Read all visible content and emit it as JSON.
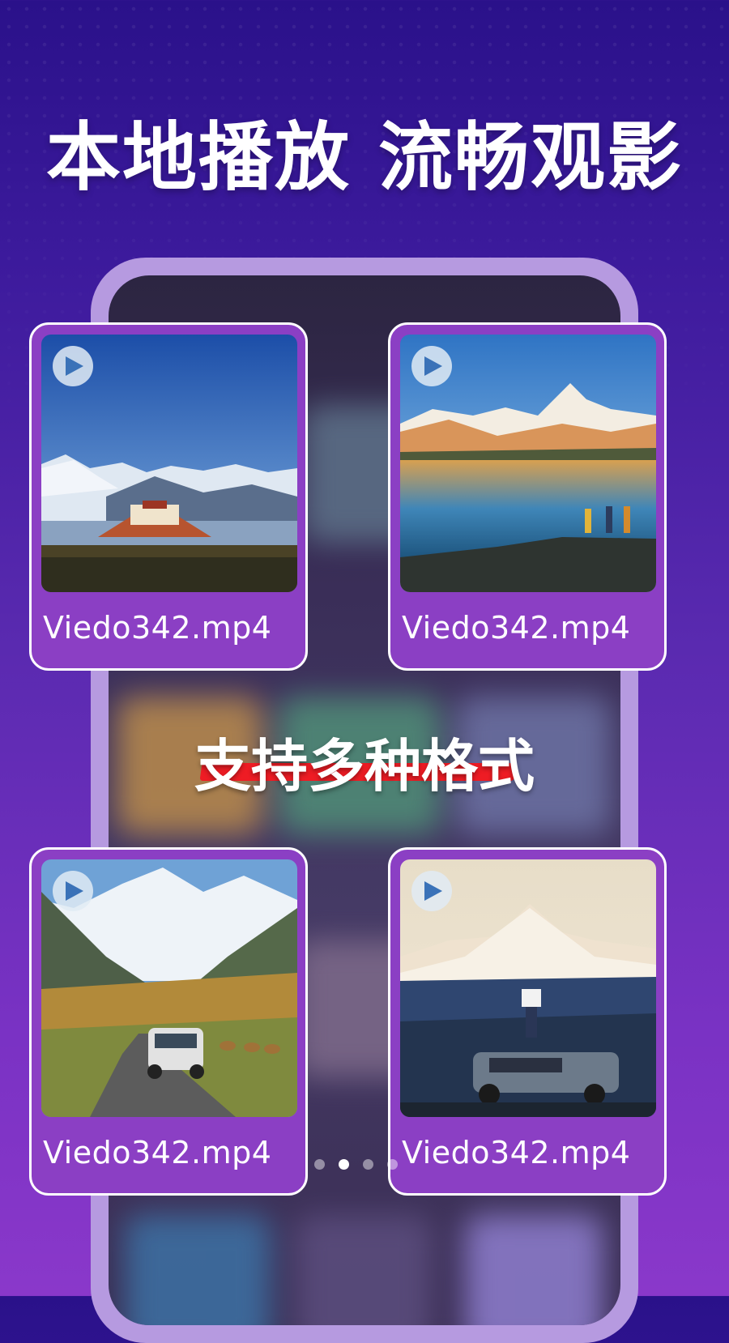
{
  "headline": "本地播放 流畅观影",
  "feature_caption": "支持多种格式",
  "videos": [
    {
      "filename": "Viedo342.mp4",
      "scene": "palace-mountains",
      "icon": "play-icon"
    },
    {
      "filename": "Viedo342.mp4",
      "scene": "lake-mountains",
      "icon": "play-icon"
    },
    {
      "filename": "Viedo342.mp4",
      "scene": "valley-road",
      "icon": "play-icon"
    },
    {
      "filename": "Viedo342.mp4",
      "scene": "summit-car",
      "icon": "play-icon"
    }
  ],
  "pager": {
    "count": 4,
    "active_index": 1
  },
  "colors": {
    "background_top": "#2a118a",
    "background_bottom": "#8a38ca",
    "card_fill": "#8b3fc4",
    "phone_frame": "#b69ae0",
    "caption_underline": "#ee1c24"
  }
}
